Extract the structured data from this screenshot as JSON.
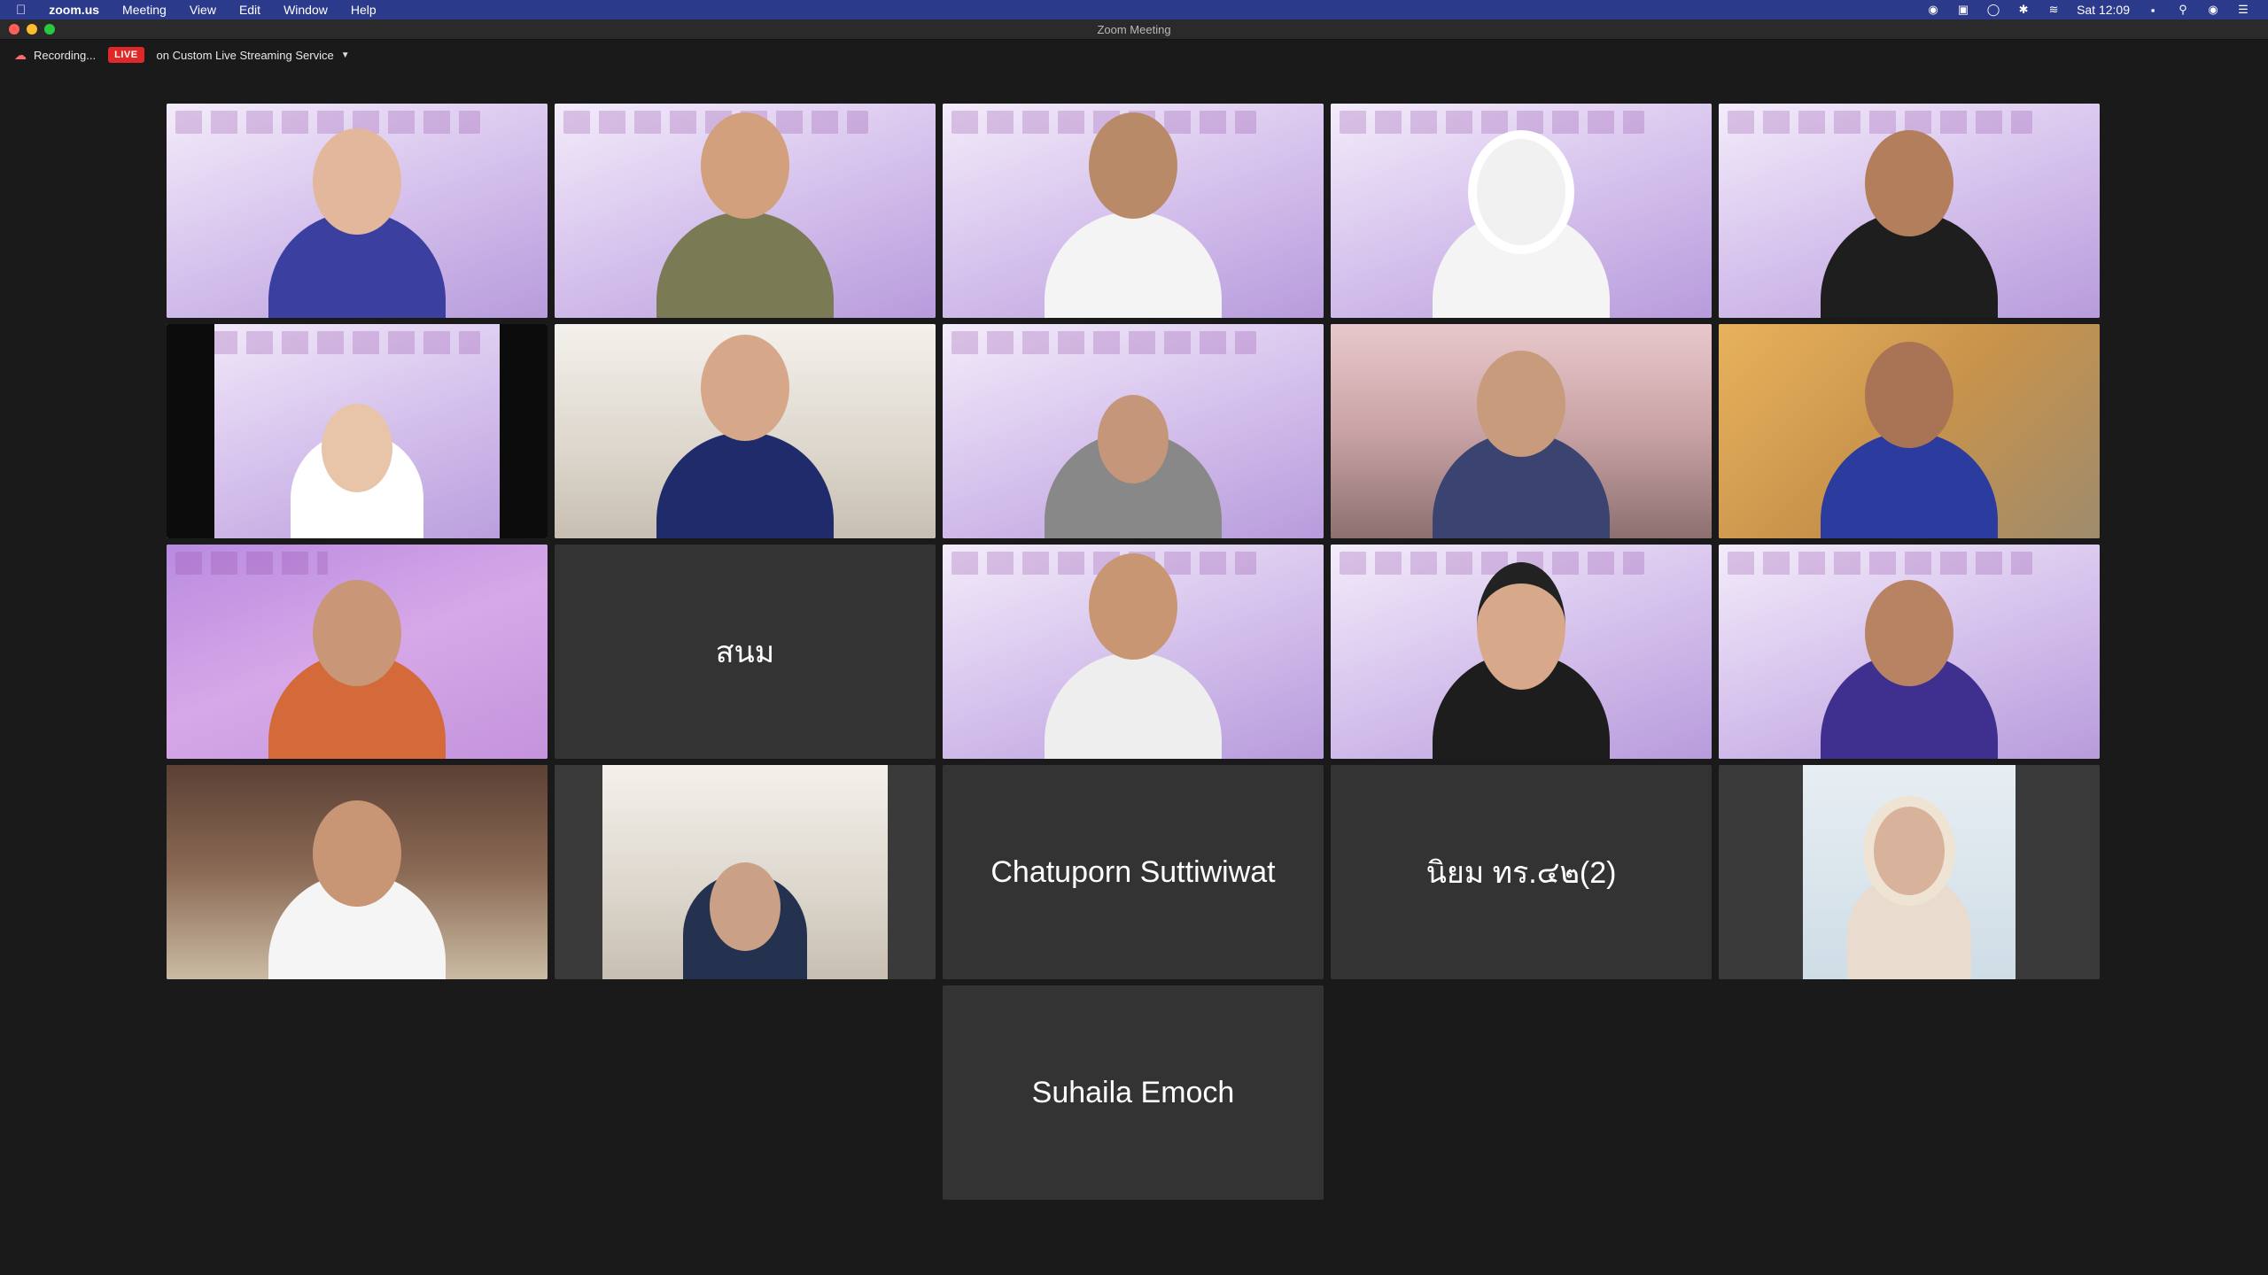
{
  "menubar": {
    "app_name": "zoom.us",
    "menus": [
      "Meeting",
      "View",
      "Edit",
      "Window",
      "Help"
    ],
    "clock": "Sat 12:09"
  },
  "window": {
    "title": "Zoom Meeting"
  },
  "status": {
    "recording_label": "Recording...",
    "live_badge": "LIVE",
    "stream_label": "on Custom Live Streaming Service"
  },
  "participants": {
    "name_only": {
      "snom": "สนม",
      "chatuporn": "Chatuporn Suttiwiwat",
      "niyom": "นิยม ทร.๔๒(2)",
      "suhaila": "Suhaila Emoch"
    }
  },
  "colors": {
    "active_speaker_border": "#43b04a",
    "live_badge": "#e02828",
    "tile_bg": "#333333"
  }
}
